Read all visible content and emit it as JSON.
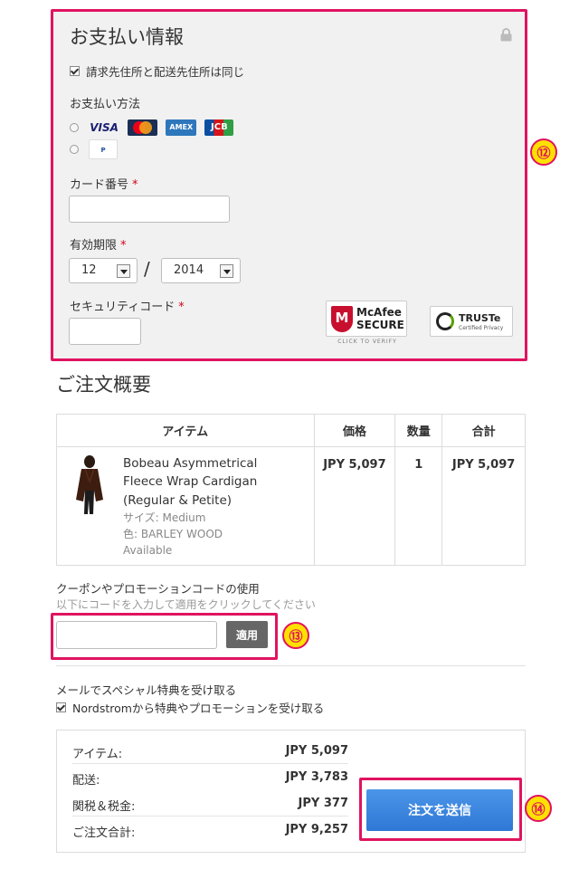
{
  "payment": {
    "title": "お支払い情報",
    "same_address_label": "請求先住所と配送先住所は同じ",
    "method_label": "お支払い方法",
    "cards": [
      {
        "name": "VISA",
        "color": "#1a1f71"
      },
      {
        "name": "MasterCard",
        "color": "#eb001b"
      },
      {
        "name": "AMEX",
        "color": "#2e77bc"
      },
      {
        "name": "JCB",
        "color": "#0b4ea2"
      }
    ],
    "paypal_label": "PayPal",
    "card_number_label": "カード番号",
    "required_mark": "*",
    "expiry_label": "有効期限",
    "expiry_month": "12",
    "expiry_separator": "/",
    "expiry_year": "2014",
    "security_code_label": "セキュリティコード",
    "mcafee": {
      "line1": "McAfee",
      "line2": "SECURE",
      "caption": "CLICK TO VERIFY",
      "badge": "M"
    },
    "truste": {
      "name": "TRUSTe",
      "caption": "Certified Privacy"
    }
  },
  "summary": {
    "title": "ご注文概要",
    "columns": [
      "アイテム",
      "価格",
      "数量",
      "合計"
    ],
    "item": {
      "name_lines": [
        "Bobeau Asymmetrical",
        "Fleece Wrap Cardigan",
        "(Regular & Petite)"
      ],
      "size": "サイズ: Medium",
      "color": "色: BARLEY WOOD",
      "availability": "Available",
      "price": "JPY 5,097",
      "qty": "1",
      "total": "JPY 5,097"
    }
  },
  "coupon": {
    "label": "クーポンやプロモーションコードの使用",
    "hint": "以下にコードを入力して適用をクリックしてください",
    "apply": "適用"
  },
  "newsletter": {
    "title": "メールでスペシャル特典を受け取る",
    "checkbox_label": "Nordstromから特典やプロモーションを受け取る"
  },
  "totals": {
    "rows": [
      {
        "label": "アイテム:",
        "value": "JPY 5,097"
      },
      {
        "label": "配送:",
        "value": "JPY 3,783"
      },
      {
        "label": "関税＆税金:",
        "value": "JPY 377"
      },
      {
        "label": "ご注文合計:",
        "value": "JPY 9,257"
      }
    ],
    "submit": "注文を送信"
  },
  "callouts": [
    "⑫",
    "⑬",
    "⑭"
  ],
  "colors": {
    "highlight": "#e0135f",
    "callout_fill": "#ffe100",
    "submit": "#3a82dd"
  }
}
